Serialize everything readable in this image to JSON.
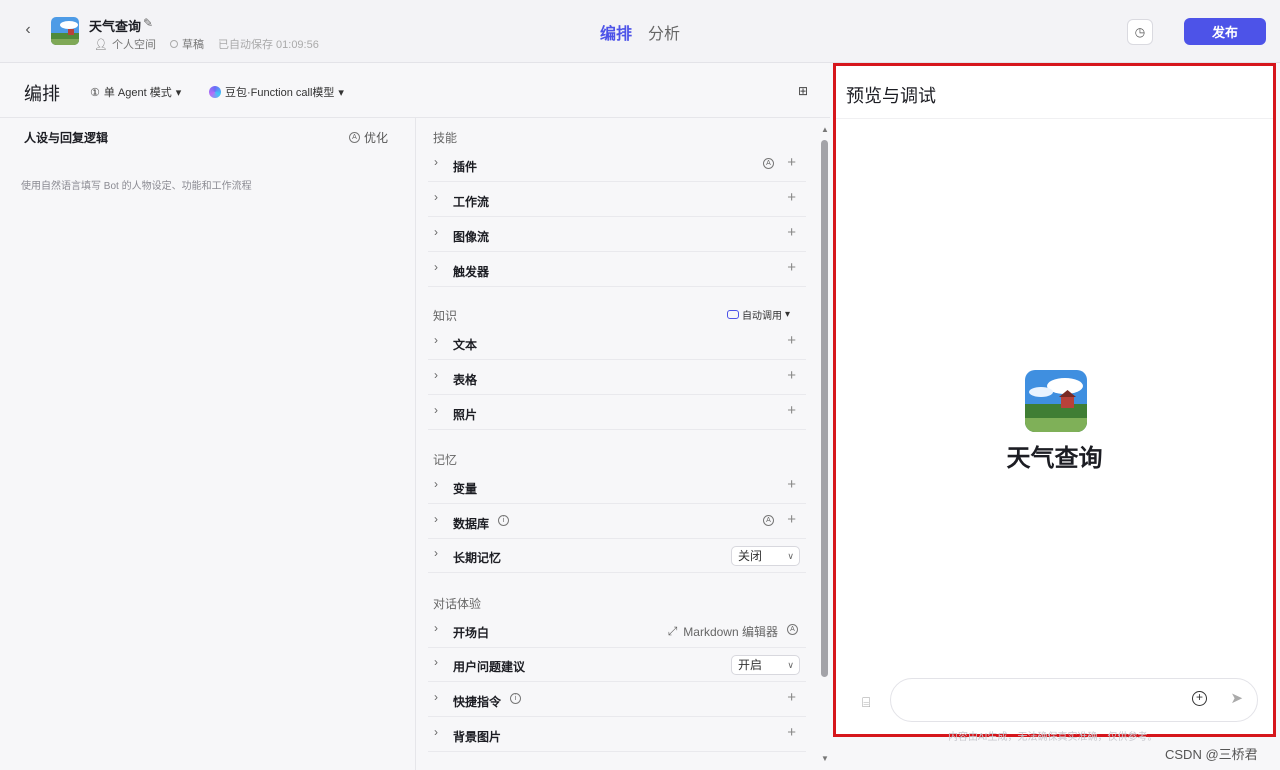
{
  "header": {
    "bot_name": "天气查询",
    "space": "个人空间",
    "status": "草稿",
    "autosave": "已自动保存 01:09:56",
    "tabs": [
      {
        "label": "编排",
        "active": true
      },
      {
        "label": "分析",
        "active": false
      }
    ],
    "publish_label": "发布",
    "accent_color": "#4d53e8"
  },
  "toolbar": {
    "title": "编排",
    "mode": "单 Agent 模式",
    "model": "豆包·Function call模型"
  },
  "persona": {
    "title": "人设与回复逻辑",
    "optimize_label": "优化",
    "placeholder": "使用自然语言填写 Bot 的人物设定、功能和工作流程"
  },
  "skills": {
    "groups": {
      "skill": "技能",
      "knowledge": "知识",
      "memory": "记忆",
      "dialog": "对话体验"
    },
    "auto_call_label": "自动调用",
    "rows": {
      "plugin": "插件",
      "workflow": "工作流",
      "imageflow": "图像流",
      "trigger": "触发器",
      "text": "文本",
      "table": "表格",
      "photo": "照片",
      "variable": "变量",
      "database": "数据库",
      "longterm": "长期记忆",
      "opening": "开场白",
      "suggest": "用户问题建议",
      "shortcut": "快捷指令",
      "background": "背景图片"
    },
    "longterm_value": "关闭",
    "suggest_value": "开启",
    "markdown_label": "Markdown 编辑器"
  },
  "preview": {
    "title": "预览与调试",
    "bot_name": "天气查询",
    "highlight_color": "#d6161c"
  },
  "footer": {
    "disclaimer": "内容由AI生成，无法确保真实准确，仅供参考。",
    "watermark": "CSDN @三桥君"
  }
}
